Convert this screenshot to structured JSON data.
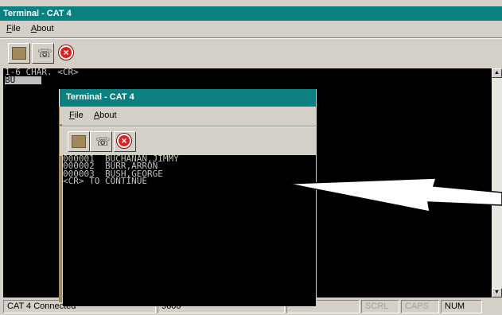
{
  "outer": {
    "title": "Terminal - CAT 4",
    "menu": [
      {
        "underline": "F",
        "rest": "ile"
      },
      {
        "underline": "A",
        "rest": "bout"
      }
    ],
    "toolbar": [
      {
        "icon": "blank-square-icon"
      },
      {
        "icon": "phone-icon"
      },
      {
        "icon": "stop-icon"
      }
    ],
    "terminal_lines": [
      "1-6 CHAR. <CR>"
    ],
    "terminal_input": "BU"
  },
  "inner": {
    "title": "Terminal - CAT 4",
    "menu": [
      {
        "underline": "F",
        "rest": "ile"
      },
      {
        "underline": "A",
        "rest": "bout"
      }
    ],
    "terminal_lines": [
      "000001  BUCHANAN,JIMMY",
      "000002  BURR,ARRON",
      "000003  BUSH,GEORGE",
      "",
      "<CR> TO CONTINUE"
    ]
  },
  "status": {
    "connection": "CAT 4  Connected",
    "baud": "9600",
    "blank": "",
    "scrl": "SCRL",
    "caps": "CAPS",
    "num": "NUM"
  },
  "colors": {
    "titlebar": "#0a8080",
    "terminal_bg": "#000000",
    "terminal_fg": "#c0c0c0",
    "chrome": "#d4d0c8"
  }
}
